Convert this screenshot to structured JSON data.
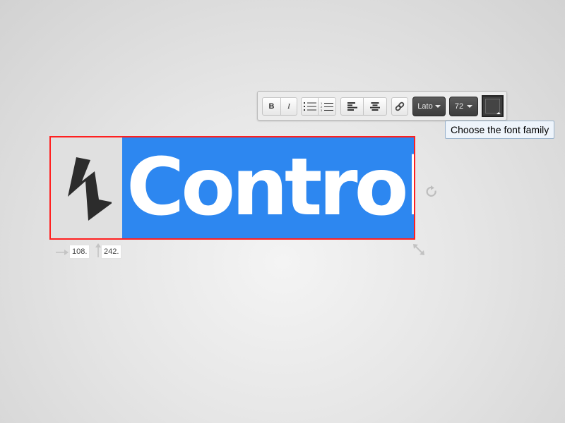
{
  "toolbar": {
    "bold_label": "B",
    "italic_label": "I",
    "font_family": "Lato",
    "font_size": "72",
    "text_color": "#444444",
    "icons": [
      "bulleted-list-icon",
      "numbered-list-icon",
      "align-left-icon",
      "align-center-icon",
      "link-icon",
      "color-picker-icon"
    ]
  },
  "tooltip": {
    "text": "Choose the font family"
  },
  "element": {
    "text": "Control",
    "background_color": "#2d87f0",
    "logo_icon": "lightning-bolt-icon",
    "border_color": "#ff2020"
  },
  "position": {
    "x": "108.",
    "y": "242."
  }
}
